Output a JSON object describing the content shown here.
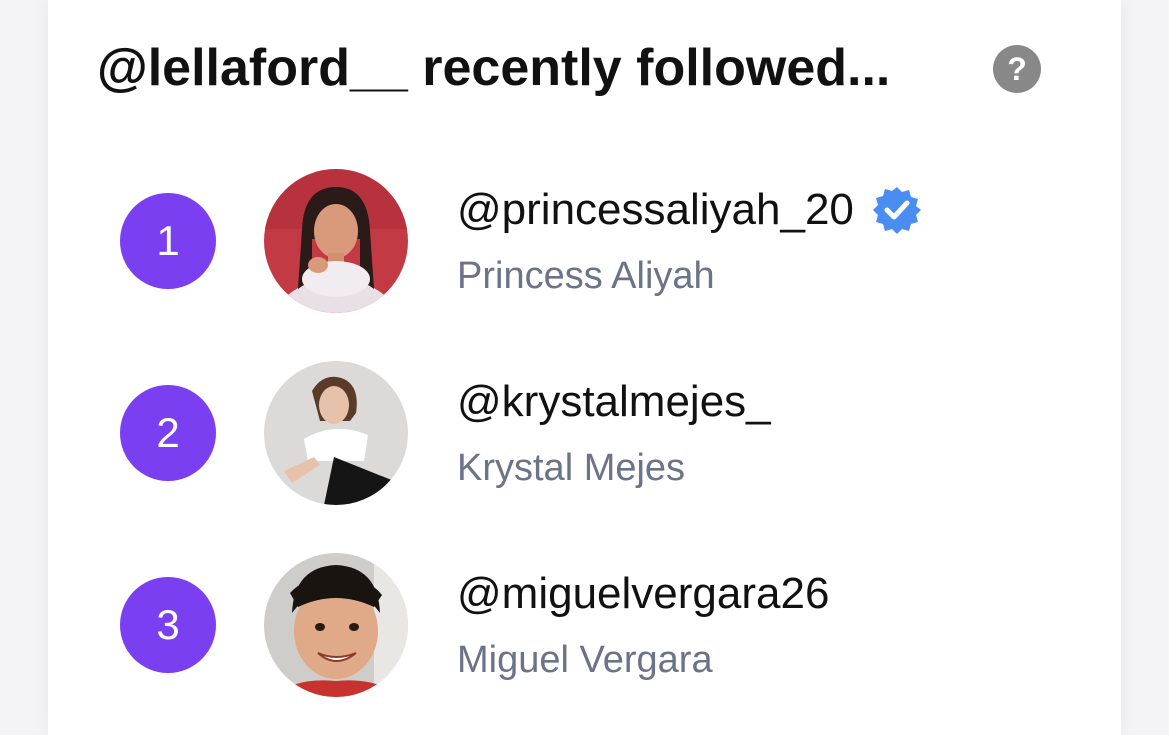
{
  "header": {
    "title": "@lellaford__ recently followed...",
    "help_icon": "question-circle-icon",
    "help_glyph": "?"
  },
  "colors": {
    "badge": "#7b3ff2",
    "verified": "#4a8df0",
    "help": "#888888",
    "secondary_text": "#6b7388"
  },
  "follows": [
    {
      "rank": "1",
      "username": "@princessaliyah_20",
      "display_name": "Princess Aliyah",
      "verified": true
    },
    {
      "rank": "2",
      "username": "@krystalmejes_",
      "display_name": "Krystal Mejes",
      "verified": false
    },
    {
      "rank": "3",
      "username": "@miguelvergara26",
      "display_name": "Miguel Vergara",
      "verified": false
    }
  ]
}
